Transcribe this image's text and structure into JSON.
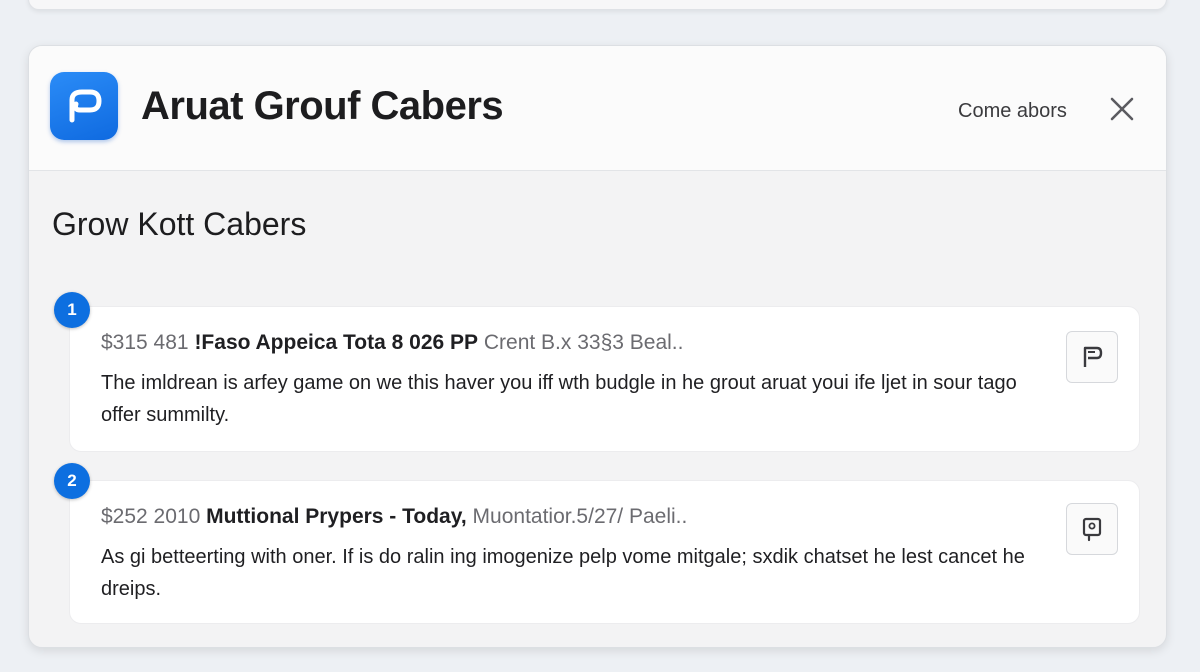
{
  "dialog": {
    "title": "Aruat Grouf Cabers",
    "header_action_label": "Come abors",
    "icons": {
      "app": "app-logo-icon",
      "close": "close-icon"
    }
  },
  "section": {
    "title": "Grow Kott Cabers"
  },
  "items": [
    {
      "number": "1",
      "price": "$315 481 ",
      "title": "!Faso Appeica Tota 8 026 PP",
      "detail": " Crent B.x 33§3 Beal..",
      "description": "The imldrean is arfey game on we this haver you iff wth budgle in he grout aruat youi ife ljet in sour tago offer summilty.",
      "action_icon": "flag-icon"
    },
    {
      "number": "2",
      "price": "$252 2010 ",
      "title": "Muttional Prypers - Today,",
      "detail": " Muontatior.5/27/ Paeli..",
      "description": "As gi betteerting with oner. If is do ralin ing imogenize pelp vome mitgale; sxdik chatset he lest cancet he dreips.",
      "action_icon": "report-icon"
    }
  ],
  "colors": {
    "accent": "#0d6fe0",
    "app_icon": "#1a7cf0",
    "page_background": "#edf0f4"
  }
}
